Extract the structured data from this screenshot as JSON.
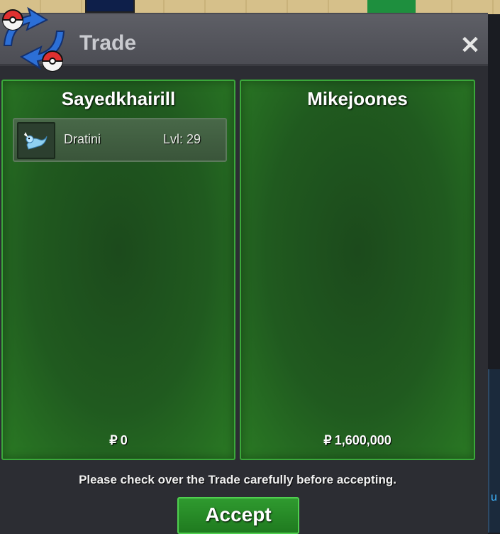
{
  "window": {
    "title": "Trade",
    "close_symbol": "✕"
  },
  "left_panel": {
    "player_name": "Sayedkhairill",
    "items": [
      {
        "pokemon": "Dratini",
        "level": "Lvl: 29"
      }
    ],
    "money_symbol": "₽",
    "money": "0"
  },
  "right_panel": {
    "player_name": "Mikejoones",
    "money_symbol": "₽",
    "money": "1,600,000"
  },
  "notice": "Please check over the Trade carefully before accepting.",
  "accept_label": "Accept",
  "side_hud_letter": "u",
  "colors": {
    "panel_green": "#205a1f",
    "panel_border": "#3aa83a",
    "window_bg": "#2c2d33",
    "accept_green": "#2f9a2f"
  }
}
